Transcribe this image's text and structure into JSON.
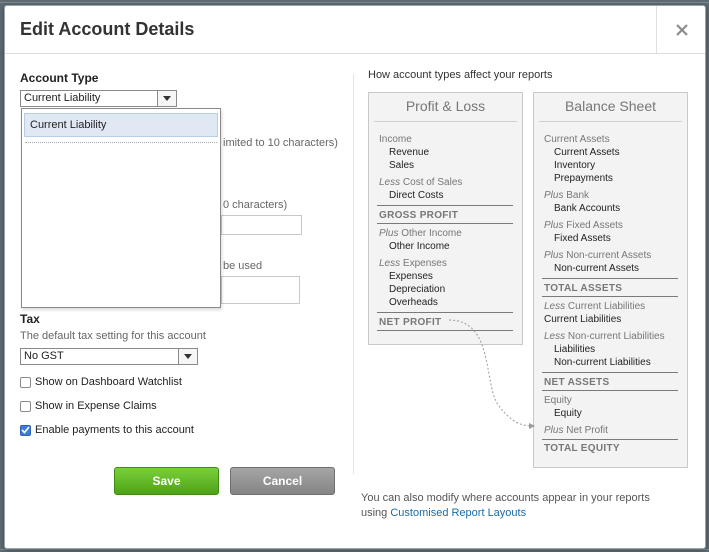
{
  "dialog": {
    "title": "Edit Account Details"
  },
  "form": {
    "account_type_label": "Account Type",
    "account_type_value": "Current Liability",
    "dropdown_selected": "Current Liability",
    "behind_code_hint": "imited to 10 characters)",
    "behind_name_hint": "0 characters)",
    "behind_desc_hint": "be used",
    "tax_label": "Tax",
    "tax_hint": "The default tax setting for this account",
    "tax_value": "No GST",
    "checkboxes": [
      {
        "label": "Show on Dashboard Watchlist",
        "checked": false
      },
      {
        "label": "Show in Expense Claims",
        "checked": false
      },
      {
        "label": "Enable payments to this account",
        "checked": true
      }
    ],
    "save_label": "Save",
    "cancel_label": "Cancel"
  },
  "reports": {
    "heading": "How account types affect your reports",
    "pl": {
      "title": "Profit & Loss",
      "income": "Income",
      "revenue": "Revenue",
      "sales": "Sales",
      "less1": "Less",
      "cost_of_sales": "Cost of Sales",
      "direct_costs": "Direct Costs",
      "gross_profit": "GROSS PROFIT",
      "plus1": "Plus",
      "other_income_hdr": "Other Income",
      "other_income": "Other Income",
      "less2": "Less",
      "expenses_hdr": "Expenses",
      "expenses": "Expenses",
      "depreciation": "Depreciation",
      "overheads": "Overheads",
      "net_profit": "NET PROFIT"
    },
    "bs": {
      "title": "Balance Sheet",
      "current_assets_hdr": "Current Assets",
      "current_assets": "Current Assets",
      "inventory": "Inventory",
      "prepayments": "Prepayments",
      "plus1": "Plus",
      "bank_hdr": "Bank",
      "bank_accounts": "Bank Accounts",
      "plus2": "Plus",
      "fixed_assets_hdr": "Fixed Assets",
      "fixed_assets": "Fixed Assets",
      "plus3": "Plus",
      "noncurrent_assets_hdr": "Non-current Assets",
      "noncurrent_assets": "Non-current Assets",
      "total_assets": "TOTAL ASSETS",
      "less1": "Less",
      "current_liabilities_hdr": "Current Liabilities",
      "current_liabilities": "Current Liabilities",
      "less2": "Less",
      "noncurrent_liabilities_hdr": "Non-current Liabilities",
      "liabilities": "Liabilities",
      "noncurrent_liabilities": "Non-current Liabilities",
      "net_assets": "NET ASSETS",
      "equity_hdr": "Equity",
      "equity": "Equity",
      "plus4": "Plus",
      "net_profit": "Net Profit",
      "total_equity": "TOTAL EQUITY"
    },
    "footer_text": "You can also modify where accounts appear in your reports",
    "footer_using": "using",
    "footer_link": "Customised Report Layouts"
  },
  "colors": {
    "save_button": "#5cb31f",
    "cancel_button": "#959595",
    "link": "#1a6ca8",
    "checkbox_checked": "#3d7dd8"
  },
  "icons": {
    "close": "close-icon",
    "dropdown_arrow": "chevron-down-icon",
    "checkmark": "checkmark-icon"
  }
}
